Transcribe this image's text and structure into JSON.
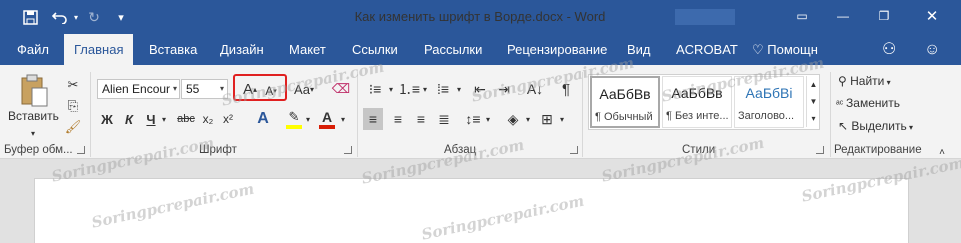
{
  "window": {
    "title": "Как изменить шрифт в Ворде.docx - Word"
  },
  "tabs": [
    "Файл",
    "Главная",
    "Вставка",
    "Дизайн",
    "Макет",
    "Ссылки",
    "Рассылки",
    "Рецензирование",
    "Вид",
    "ACROBAT"
  ],
  "help": {
    "label": "Помощн"
  },
  "clipboard": {
    "paste": "Вставить",
    "group": "Буфер обм..."
  },
  "font": {
    "name": "Alien Encour",
    "size": "55",
    "grow": "A",
    "shrink": "A",
    "case": "Aa",
    "bold": "Ж",
    "italic": "К",
    "underline": "Ч",
    "strike": "abc",
    "sub": "x₂",
    "sup": "x²",
    "group": "Шрифт"
  },
  "paragraph": {
    "group": "Абзац"
  },
  "styles": {
    "items": [
      {
        "preview": "АаБбВв",
        "name": "¶ Обычный"
      },
      {
        "preview": "АаБбВв",
        "name": "¶ Без инте..."
      },
      {
        "preview": "АаБбВі",
        "name": "Заголово..."
      }
    ],
    "group": "Стили"
  },
  "editing": {
    "find": "Найти",
    "replace": "Заменить",
    "select": "Выделить",
    "group": "Редактирование"
  },
  "watermark": "Soringpcrepair.com",
  "colors": {
    "accent": "#2b579a",
    "highlight_border": "#e02020",
    "font_color": "#d81e06",
    "highlight_color": "#ffff00"
  }
}
